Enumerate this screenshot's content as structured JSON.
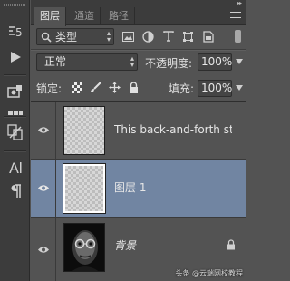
{
  "tabs": [
    {
      "label": "图层",
      "active": true
    },
    {
      "label": "通道",
      "active": false
    },
    {
      "label": "路径",
      "active": false
    }
  ],
  "filter": {
    "kind_label": "类型",
    "icons": [
      "pixel-filter-icon",
      "adjustment-filter-icon",
      "type-filter-icon",
      "shape-filter-icon",
      "smart-object-filter-icon"
    ]
  },
  "blend": {
    "mode": "正常",
    "opacity_label": "不透明度:",
    "opacity_value": "100%"
  },
  "lock": {
    "label": "锁定:",
    "fill_label": "填充:",
    "fill_value": "100%"
  },
  "layers": [
    {
      "name": "This back-and-forth st...",
      "visible": true,
      "selected": false,
      "locked": false
    },
    {
      "name": "图层 1",
      "visible": true,
      "selected": true,
      "locked": false
    },
    {
      "name": "背景",
      "visible": true,
      "selected": false,
      "locked": true
    }
  ],
  "watermark": "头条 @云端网校教程",
  "colors": {
    "panel_bg": "#535353",
    "selected_row": "#7185a2",
    "toolstrip_bg": "#3c3c3c"
  }
}
